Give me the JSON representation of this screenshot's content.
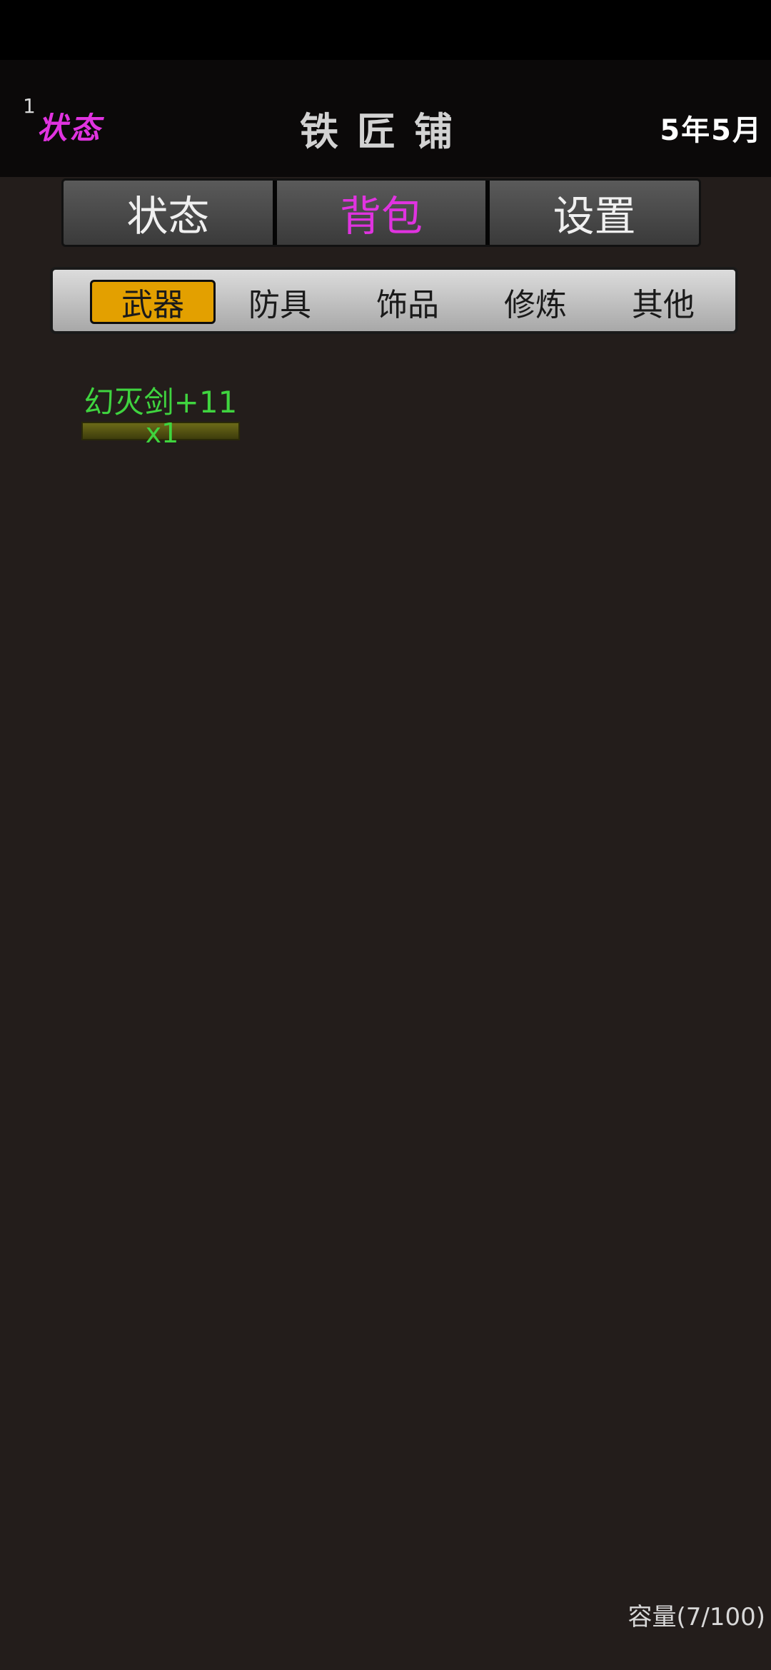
{
  "header": {
    "level": "1",
    "status_link": "状态",
    "title": "铁匠铺",
    "date": "5年5月"
  },
  "main_tabs": [
    {
      "label": "状态",
      "active": false
    },
    {
      "label": "背包",
      "active": true
    },
    {
      "label": "设置",
      "active": false
    }
  ],
  "sub_tabs": [
    {
      "label": "武器",
      "active": true
    },
    {
      "label": "防具",
      "active": false
    },
    {
      "label": "饰品",
      "active": false
    },
    {
      "label": "修炼",
      "active": false
    },
    {
      "label": "其他",
      "active": false
    }
  ],
  "inventory": {
    "items": [
      {
        "name": "幻灭剑+11",
        "qty": "x1"
      }
    ],
    "capacity": "容量(7/100)"
  },
  "colors": {
    "accent_magenta": "#e033e0",
    "active_subtab": "#e3a000",
    "item_green": "#3fd43f",
    "background": "#231d1b"
  }
}
